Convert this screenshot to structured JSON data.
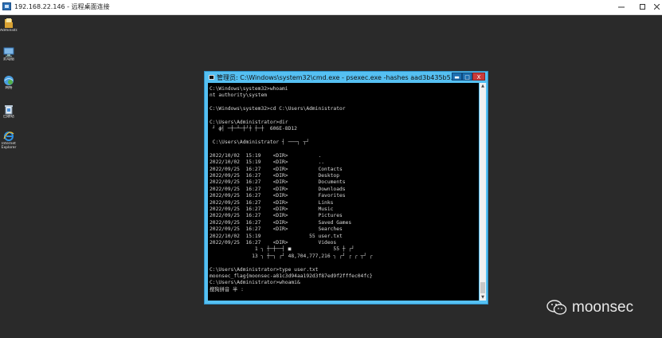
{
  "rdp": {
    "title": "192.168.22.146 - 远程桌面连接",
    "minimize_icon": "minimize-icon",
    "maximize_icon": "maximize-icon",
    "close_icon": "close-icon"
  },
  "desktop": {
    "icons": [
      {
        "name": "folder-icon",
        "label": "Administr..."
      },
      {
        "name": "computer-icon",
        "label": "此电脑"
      },
      {
        "name": "network-icon",
        "label": "网络"
      },
      {
        "name": "recycle-bin-icon",
        "label": "回收站"
      },
      {
        "name": "ie-icon",
        "label": "Internet Explorer"
      }
    ]
  },
  "cmd": {
    "title": "管理员: C:\\Windows\\system32\\cmd.exe - psexec.exe  -hashes  aad3b435b5...",
    "lines": [
      "C:\\Windows\\system32>whoami",
      "nt authority\\system",
      "",
      "C:\\Windows\\system32>cd C:\\Users\\Administrator",
      "",
      "C:\\Users\\Administrator>dir",
      " ┘ ф┤ ─┼─┴─┼┘┼ ┼─┼  606E-8D12",
      "",
      " C:\\Users\\Administrator ┤ ───┐ ┬┘",
      "",
      "2022/10/02  15:19    <DIR>          .",
      "2022/10/02  15:19    <DIR>          ..",
      "2022/09/25  16:27    <DIR>          Contacts",
      "2022/09/25  16:27    <DIR>          Desktop",
      "2022/09/25  16:27    <DIR>          Documents",
      "2022/09/25  16:27    <DIR>          Downloads",
      "2022/09/25  16:27    <DIR>          Favorites",
      "2022/09/25  16:27    <DIR>          Links",
      "2022/09/25  16:27    <DIR>          Music",
      "2022/09/25  16:27    <DIR>          Pictures",
      "2022/09/25  16:27    <DIR>          Saved Games",
      "2022/09/25  16:27    <DIR>          Searches",
      "2022/10/02  15:19                55 user.txt",
      "2022/09/25  16:27    <DIR>          Videos",
      "               1 ┐ ┼─┼──┤ ■              55 ┼ ┌┘",
      "              13 ┐ ┼─┐ ┌┘ 48,704,777,216 ┐ ┌┘ ┌ ┌ ┬┘ ┌",
      "",
      "C:\\Users\\Administrator>type user.txt",
      "moonsec_flag{moonsec-a81c3d94aa192d3f87ed9f2fffec04fc}",
      "C:\\Users\\Administrator>whoami&",
      "搜狗拼音 半 :"
    ],
    "minimize_label": "▬",
    "maximize_label": "□",
    "close_label": "X",
    "scroll_up_icon": "scroll-up-icon",
    "scroll_down_icon": "scroll-down-icon"
  },
  "watermark": {
    "icon": "wechat-icon",
    "text": "moonsec"
  }
}
